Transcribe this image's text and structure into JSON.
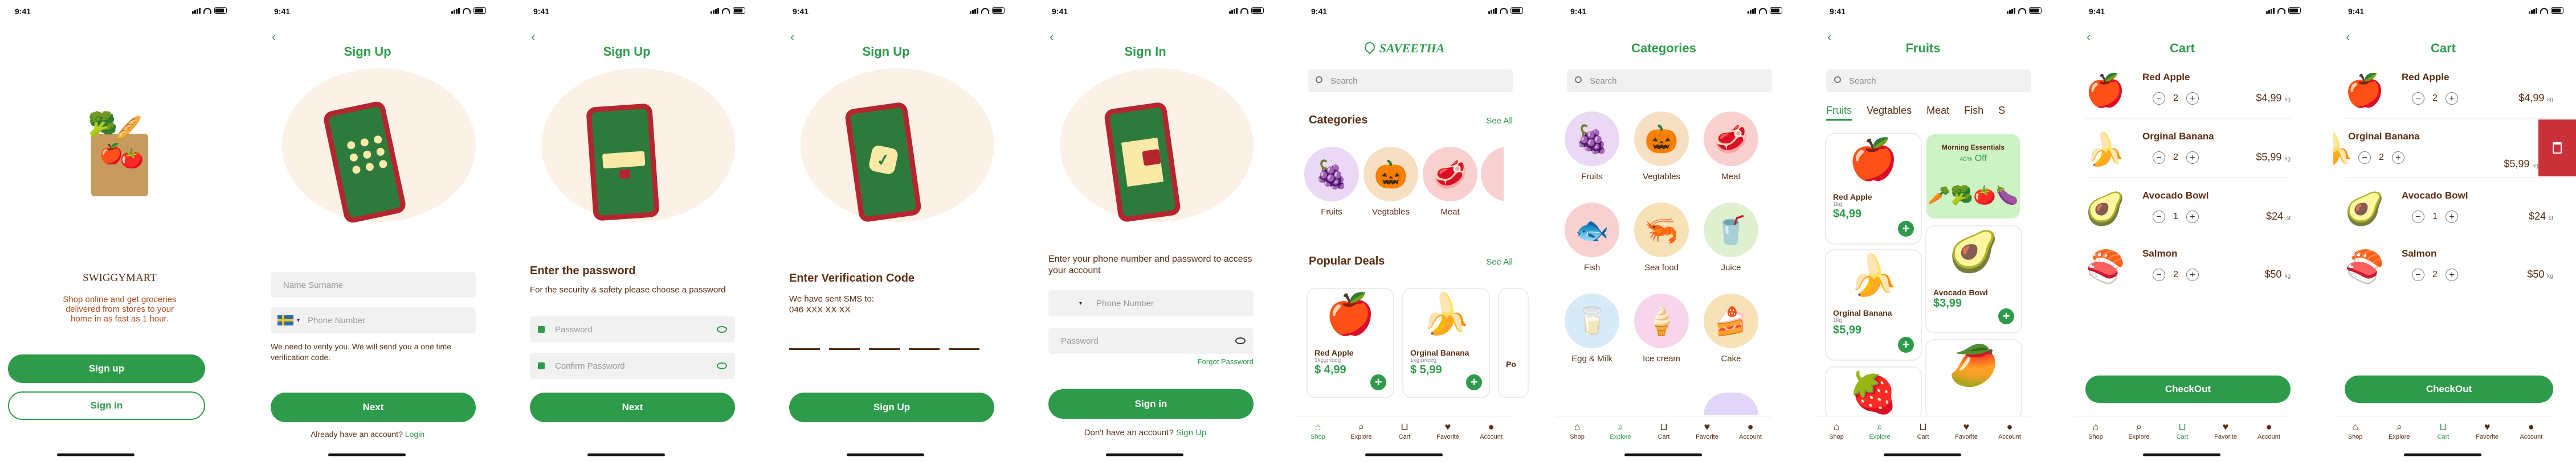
{
  "status": {
    "time": "9:41"
  },
  "welcome": {
    "brand": "SWIGGYMART",
    "tagline": "Shop online and get groceries delivered from stores to your home in as fast as 1 hour.",
    "signup": "Sign up",
    "signin": "Sign in"
  },
  "signup1": {
    "title": "Sign Up",
    "name_placeholder": "Name Surname",
    "phone_placeholder": "Phone Number",
    "note": "We need to verify you. We will send you a one time verification code.",
    "next": "Next",
    "have_account": "Already have an account?",
    "login": "Login"
  },
  "signup2": {
    "title": "Sign Up",
    "heading": "Enter the password",
    "desc": "For the security & safety please choose a password",
    "password_placeholder": "Password",
    "confirm_placeholder": "Confirm Password",
    "next": "Next"
  },
  "signup3": {
    "title": "Sign Up",
    "heading": "Enter Verification Code",
    "desc1": "We have sent SMS to:",
    "desc2": "046 XXX XX XX",
    "button": "Sign Up"
  },
  "signin": {
    "title": "Sign In",
    "desc": "Enter your phone number and password to access your account",
    "phone_placeholder": "Phone Number",
    "password_placeholder": "Password",
    "forgot": "Forgot Password",
    "button": "Sign in",
    "no_account": "Don't have an account?",
    "signup": "Sign Up"
  },
  "home": {
    "logo": "SAVEETHA",
    "search": "Search",
    "categories_title": "Categories",
    "see_all": "See All",
    "categories": [
      "Fruits",
      "Vegtables",
      "Meat"
    ],
    "deals_title": "Popular Deals",
    "deals": [
      {
        "name": "Red Apple",
        "weight": "1kg,priceg",
        "price": "$ 4,99"
      },
      {
        "name": "Orginal Banana",
        "weight": "1kg,priceg",
        "price": "$ 5,99"
      },
      {
        "name": "Po",
        "weight": "",
        "price": ""
      }
    ]
  },
  "categories_page": {
    "title": "Categories",
    "search": "Search",
    "items": [
      "Fruits",
      "Vegtables",
      "Meat",
      "Fish",
      "Sea food",
      "Juice",
      "Egg & Milk",
      "Ice cream",
      "Cake"
    ]
  },
  "fruits": {
    "title": "Fruits",
    "search": "Search",
    "tabs": [
      "Fruits",
      "Vegtables",
      "Meat",
      "Fish",
      "S"
    ],
    "products": [
      {
        "name": "Red Apple",
        "weight": "1kg",
        "price": "$4,99"
      },
      {
        "name": "Orginal Banana",
        "weight": "1kg",
        "price": "$5,99"
      },
      {
        "name": "Avocado Bowl",
        "weight": "1kg",
        "price": "$3,99"
      }
    ],
    "promo_title": "Morning Essentials",
    "promo_sub": "Off",
    "promo_pct": "40%"
  },
  "cart1": {
    "title": "Cart",
    "items": [
      {
        "name": "Red Apple",
        "qty": "2",
        "price": "$4,99",
        "unit": "kg"
      },
      {
        "name": "Orginal Banana",
        "qty": "2",
        "price": "$5,99",
        "unit": "kg"
      },
      {
        "name": "Avocado Bowl",
        "qty": "1",
        "price": "$24",
        "unit": "st"
      },
      {
        "name": "Salmon",
        "qty": "2",
        "price": "$50",
        "unit": "kg"
      }
    ],
    "checkout": "CheckOut"
  },
  "cart2": {
    "title": "Cart",
    "items": [
      {
        "name": "Red Apple",
        "qty": "2",
        "price": "$4,99",
        "unit": "kg"
      },
      {
        "name": "Orginal Banana",
        "qty": "2",
        "price": "$5,99",
        "unit": "kg"
      },
      {
        "name": "Avocado Bowl",
        "qty": "1",
        "price": "$24",
        "unit": "st"
      },
      {
        "name": "Salmon",
        "qty": "2",
        "price": "$50",
        "unit": "kg"
      }
    ],
    "checkout": "CheckOut"
  },
  "tabs": [
    "Shop",
    "Explore",
    "Cart",
    "Favorite",
    "Account"
  ],
  "colors": {
    "primary": "#2e9b4b",
    "brown": "#5a2e12",
    "phone_red": "#b5252e"
  }
}
